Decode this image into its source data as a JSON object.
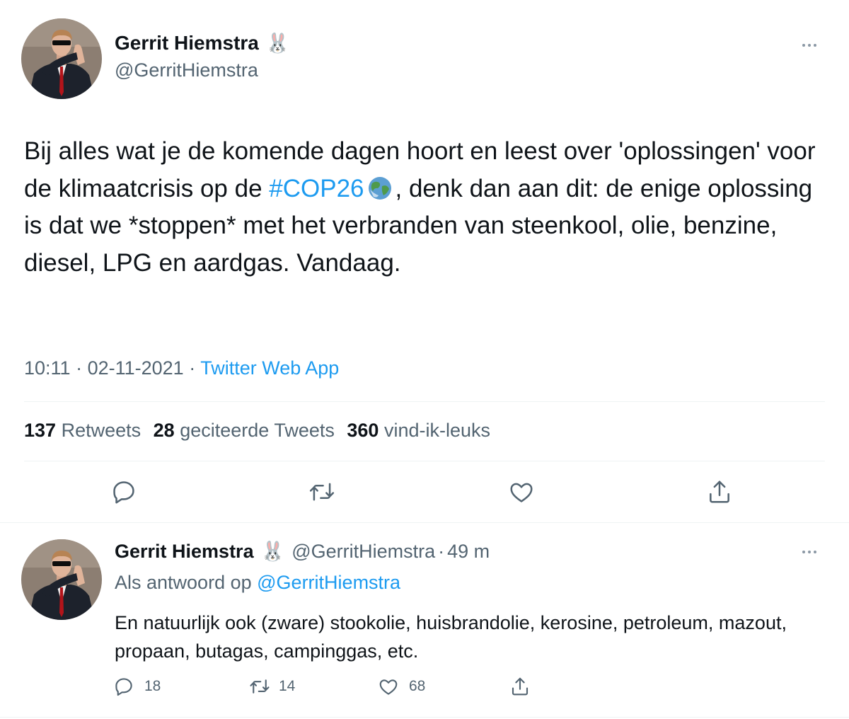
{
  "main_tweet": {
    "author_name": "Gerrit Hiemstra",
    "author_emoji": "🐰",
    "handle": "@GerritHiemstra",
    "text_part1": "Bij alles wat je de komende dagen hoort en leest over 'oplossingen' voor de klimaatcrisis op de ",
    "hashtag": "#COP26",
    "text_part2": ", denk dan aan dit: de enige oplossing is dat we *stoppen* met het verbranden van steenkool, olie, benzine, diesel, LPG en aardgas. Vandaag.",
    "time": "10:11",
    "date": "02-11-2021",
    "separator": "·",
    "source": "Twitter Web App",
    "stats": {
      "retweets_count": "137",
      "retweets_label": "Retweets",
      "quotes_count": "28",
      "quotes_label": "geciteerde Tweets",
      "likes_count": "360",
      "likes_label": "vind-ik-leuks"
    }
  },
  "reply_tweet": {
    "author_name": "Gerrit Hiemstra",
    "author_emoji": "🐰",
    "handle": "@GerritHiemstra",
    "separator": "·",
    "time_ago": "49 m",
    "reply_prefix": "Als antwoord op",
    "reply_to": "@GerritHiemstra",
    "text": "En natuurlijk ook (zware) stookolie, huisbrandolie, kerosine, petroleum, mazout, propaan, butagas, campinggas, etc.",
    "reply_count": "18",
    "retweet_count": "14",
    "like_count": "68"
  },
  "colors": {
    "accent": "#1d9bf0",
    "text": "#0f1419",
    "muted": "#536471",
    "divider": "#eff3f4"
  },
  "icons": [
    "more-icon",
    "reply-icon",
    "retweet-icon",
    "like-icon",
    "share-icon",
    "earth-emoji",
    "rabbit-emoji"
  ]
}
